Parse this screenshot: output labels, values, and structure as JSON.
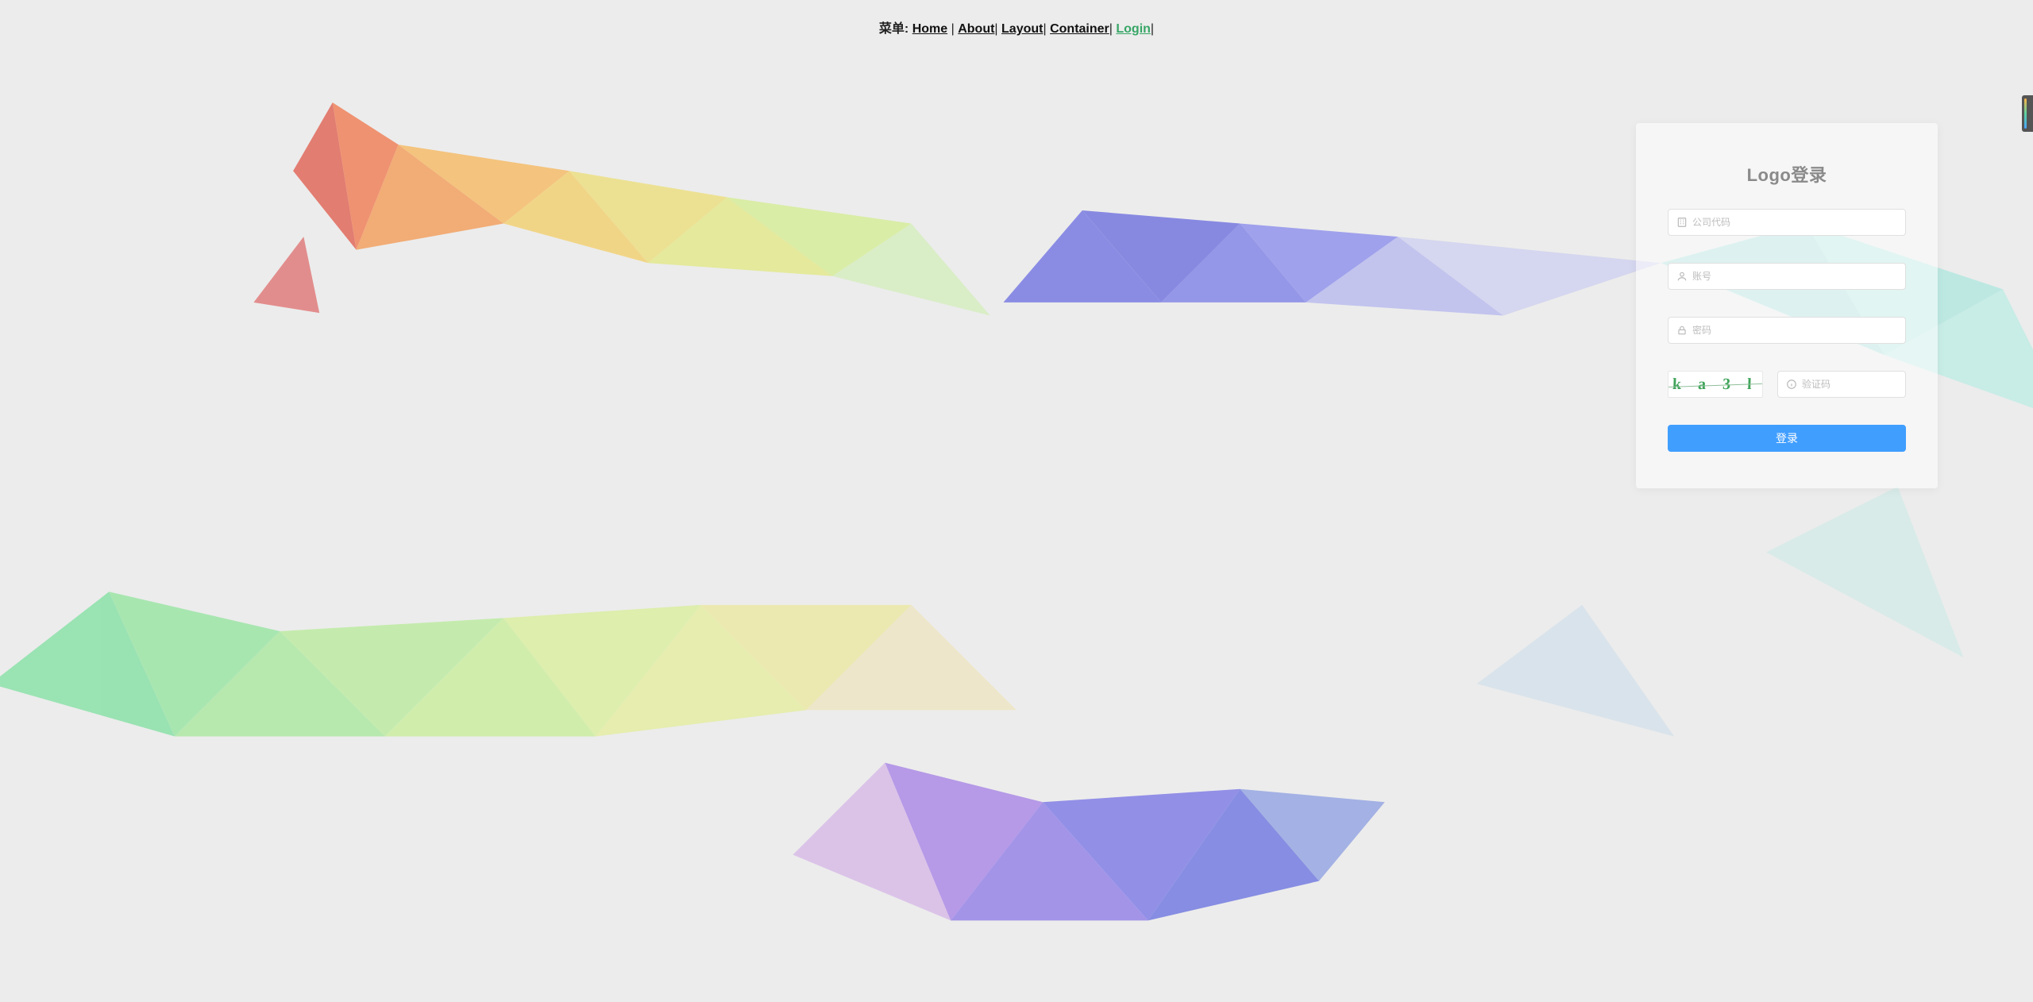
{
  "menu": {
    "label": "菜单:",
    "items": [
      {
        "id": "home",
        "label": "Home",
        "active": false
      },
      {
        "id": "about",
        "label": "About",
        "active": false
      },
      {
        "id": "layout",
        "label": "Layout",
        "active": false
      },
      {
        "id": "container",
        "label": "Container",
        "active": false
      },
      {
        "id": "login",
        "label": "Login",
        "active": true
      }
    ]
  },
  "login": {
    "title": "Logo登录",
    "company_code": {
      "placeholder": "公司代码",
      "value": ""
    },
    "account": {
      "placeholder": "账号",
      "value": ""
    },
    "password": {
      "placeholder": "密码",
      "value": ""
    },
    "captcha": {
      "image_text": "k a 3 l",
      "placeholder": "验证码",
      "value": ""
    },
    "submit_label": "登录"
  }
}
